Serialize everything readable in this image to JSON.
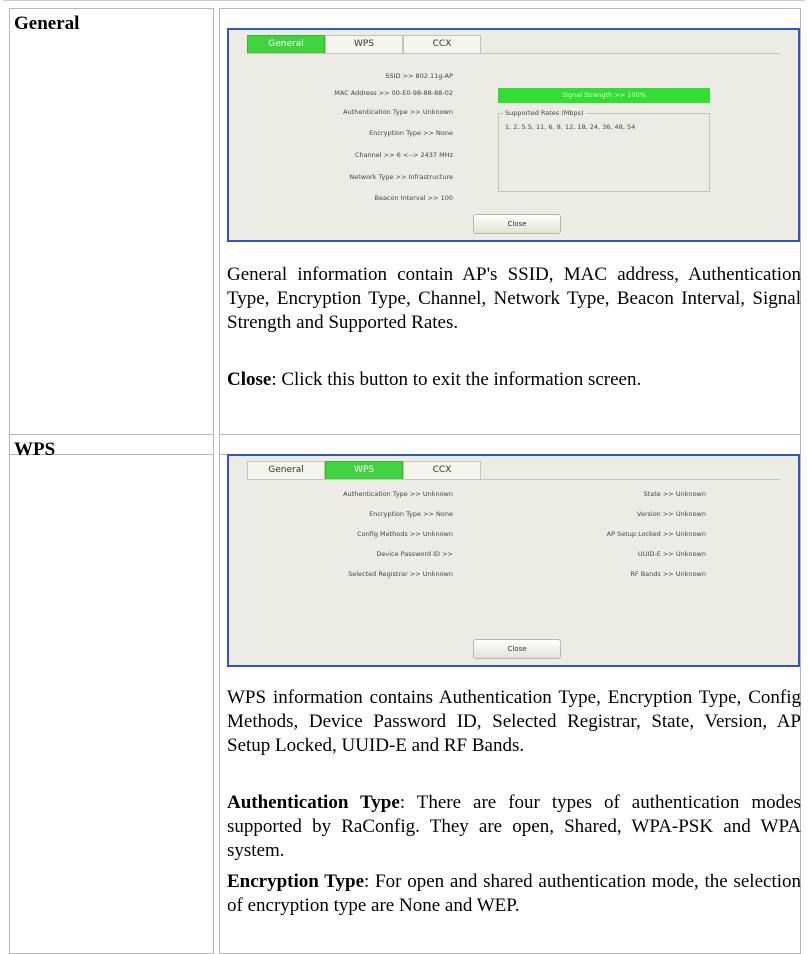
{
  "general": {
    "label": "General",
    "tabs": [
      "General",
      "WPS",
      "CCX"
    ],
    "ssid": "SSID >> 802.11g-AP",
    "mac": "MAC Address >> 00-E0-98-88-88-02",
    "auth": "Authentication Type >> Unknown",
    "enc": "Encryption Type >> None",
    "channel": "Channel >> 6 <--> 2437 MHz",
    "network": "Network Type >> Infrastructure",
    "beacon": "Beacon Interval >> 100",
    "signal": "Signal Strength >> 100%",
    "rates_title": "Supported Rates (Mbps)",
    "rates_value": "1, 2, 5.5, 11, 6, 9, 12, 18, 24, 36, 48, 54",
    "close_button": "Close",
    "description": "General information contain AP's SSID, MAC address, Authentication Type, Encryption Type, Channel, Network Type, Beacon Interval, Signal Strength and Supported Rates.",
    "close_term": "Close",
    "close_desc": ": Click this button to exit the information screen."
  },
  "wps": {
    "label": "WPS",
    "tabs": [
      "General",
      "WPS",
      "CCX"
    ],
    "auth": "Authentication Type >> Unknown",
    "enc": "Encryption Type >> None",
    "config": "Config Methods >> Unknown",
    "device_pw": "Device Password ID >>",
    "registrar": "Selected Registrar >> Unknown",
    "state": "State >> Unknown",
    "version": "Version >> Unknown",
    "ap_locked": "AP Setup Locked >> Unknown",
    "uuid": "UUID-E >> Unknown",
    "rf_bands": "RF Bands >> Unknown",
    "close_button": "Close",
    "description": "WPS information contains Authentication Type, Encryption Type, Config Methods, Device Password ID, Selected Registrar, State, Version, AP Setup Locked, UUID-E and RF Bands.",
    "auth_term": "Authentication Type",
    "auth_desc": ": There are four types of authentication modes supported by RaConfig. They are open, Shared, WPA-PSK and WPA system.",
    "enc_term": "Encryption Type",
    "enc_desc": ": For open and shared authentication mode, the selection of encryption type are None and WEP."
  }
}
